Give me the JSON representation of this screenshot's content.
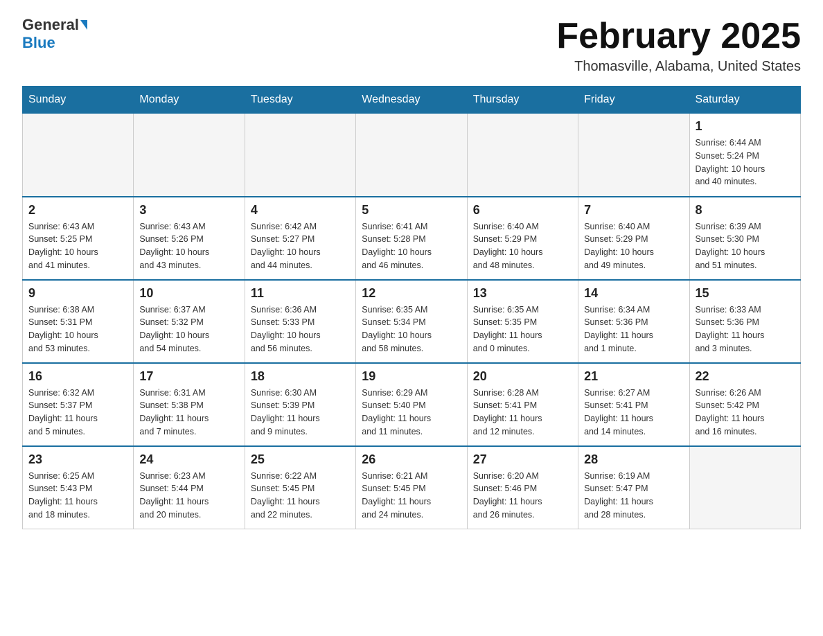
{
  "header": {
    "logo_line1": "General",
    "logo_line2": "Blue",
    "month_title": "February 2025",
    "location": "Thomasville, Alabama, United States"
  },
  "weekdays": [
    "Sunday",
    "Monday",
    "Tuesday",
    "Wednesday",
    "Thursday",
    "Friday",
    "Saturday"
  ],
  "weeks": [
    [
      {
        "day": "",
        "info": ""
      },
      {
        "day": "",
        "info": ""
      },
      {
        "day": "",
        "info": ""
      },
      {
        "day": "",
        "info": ""
      },
      {
        "day": "",
        "info": ""
      },
      {
        "day": "",
        "info": ""
      },
      {
        "day": "1",
        "info": "Sunrise: 6:44 AM\nSunset: 5:24 PM\nDaylight: 10 hours\nand 40 minutes."
      }
    ],
    [
      {
        "day": "2",
        "info": "Sunrise: 6:43 AM\nSunset: 5:25 PM\nDaylight: 10 hours\nand 41 minutes."
      },
      {
        "day": "3",
        "info": "Sunrise: 6:43 AM\nSunset: 5:26 PM\nDaylight: 10 hours\nand 43 minutes."
      },
      {
        "day": "4",
        "info": "Sunrise: 6:42 AM\nSunset: 5:27 PM\nDaylight: 10 hours\nand 44 minutes."
      },
      {
        "day": "5",
        "info": "Sunrise: 6:41 AM\nSunset: 5:28 PM\nDaylight: 10 hours\nand 46 minutes."
      },
      {
        "day": "6",
        "info": "Sunrise: 6:40 AM\nSunset: 5:29 PM\nDaylight: 10 hours\nand 48 minutes."
      },
      {
        "day": "7",
        "info": "Sunrise: 6:40 AM\nSunset: 5:29 PM\nDaylight: 10 hours\nand 49 minutes."
      },
      {
        "day": "8",
        "info": "Sunrise: 6:39 AM\nSunset: 5:30 PM\nDaylight: 10 hours\nand 51 minutes."
      }
    ],
    [
      {
        "day": "9",
        "info": "Sunrise: 6:38 AM\nSunset: 5:31 PM\nDaylight: 10 hours\nand 53 minutes."
      },
      {
        "day": "10",
        "info": "Sunrise: 6:37 AM\nSunset: 5:32 PM\nDaylight: 10 hours\nand 54 minutes."
      },
      {
        "day": "11",
        "info": "Sunrise: 6:36 AM\nSunset: 5:33 PM\nDaylight: 10 hours\nand 56 minutes."
      },
      {
        "day": "12",
        "info": "Sunrise: 6:35 AM\nSunset: 5:34 PM\nDaylight: 10 hours\nand 58 minutes."
      },
      {
        "day": "13",
        "info": "Sunrise: 6:35 AM\nSunset: 5:35 PM\nDaylight: 11 hours\nand 0 minutes."
      },
      {
        "day": "14",
        "info": "Sunrise: 6:34 AM\nSunset: 5:36 PM\nDaylight: 11 hours\nand 1 minute."
      },
      {
        "day": "15",
        "info": "Sunrise: 6:33 AM\nSunset: 5:36 PM\nDaylight: 11 hours\nand 3 minutes."
      }
    ],
    [
      {
        "day": "16",
        "info": "Sunrise: 6:32 AM\nSunset: 5:37 PM\nDaylight: 11 hours\nand 5 minutes."
      },
      {
        "day": "17",
        "info": "Sunrise: 6:31 AM\nSunset: 5:38 PM\nDaylight: 11 hours\nand 7 minutes."
      },
      {
        "day": "18",
        "info": "Sunrise: 6:30 AM\nSunset: 5:39 PM\nDaylight: 11 hours\nand 9 minutes."
      },
      {
        "day": "19",
        "info": "Sunrise: 6:29 AM\nSunset: 5:40 PM\nDaylight: 11 hours\nand 11 minutes."
      },
      {
        "day": "20",
        "info": "Sunrise: 6:28 AM\nSunset: 5:41 PM\nDaylight: 11 hours\nand 12 minutes."
      },
      {
        "day": "21",
        "info": "Sunrise: 6:27 AM\nSunset: 5:41 PM\nDaylight: 11 hours\nand 14 minutes."
      },
      {
        "day": "22",
        "info": "Sunrise: 6:26 AM\nSunset: 5:42 PM\nDaylight: 11 hours\nand 16 minutes."
      }
    ],
    [
      {
        "day": "23",
        "info": "Sunrise: 6:25 AM\nSunset: 5:43 PM\nDaylight: 11 hours\nand 18 minutes."
      },
      {
        "day": "24",
        "info": "Sunrise: 6:23 AM\nSunset: 5:44 PM\nDaylight: 11 hours\nand 20 minutes."
      },
      {
        "day": "25",
        "info": "Sunrise: 6:22 AM\nSunset: 5:45 PM\nDaylight: 11 hours\nand 22 minutes."
      },
      {
        "day": "26",
        "info": "Sunrise: 6:21 AM\nSunset: 5:45 PM\nDaylight: 11 hours\nand 24 minutes."
      },
      {
        "day": "27",
        "info": "Sunrise: 6:20 AM\nSunset: 5:46 PM\nDaylight: 11 hours\nand 26 minutes."
      },
      {
        "day": "28",
        "info": "Sunrise: 6:19 AM\nSunset: 5:47 PM\nDaylight: 11 hours\nand 28 minutes."
      },
      {
        "day": "",
        "info": ""
      }
    ]
  ]
}
